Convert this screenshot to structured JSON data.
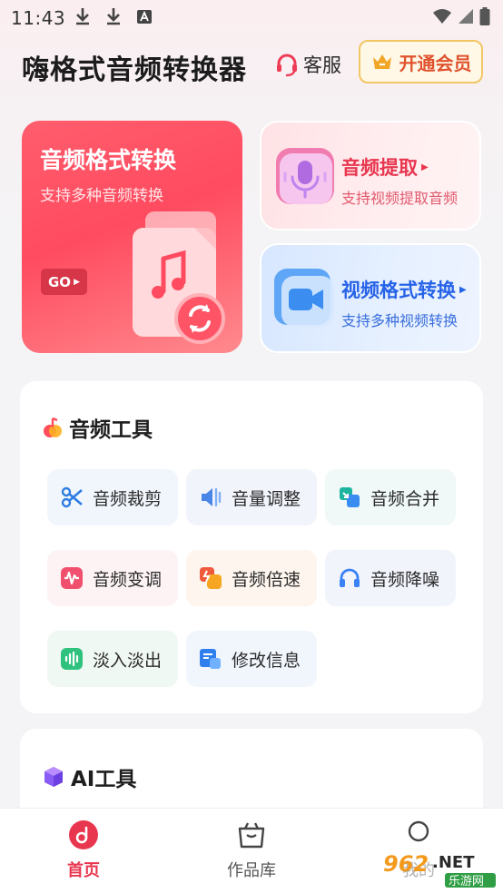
{
  "status_bar": {
    "time": "11:43",
    "icons": [
      "download-icon",
      "download-icon",
      "keyboard-a-icon",
      "wifi-icon",
      "signal-icon",
      "battery-icon"
    ]
  },
  "header": {
    "title": "嗨格式音频转换器",
    "service_label": "客服",
    "vip_label": "开通会员"
  },
  "features": {
    "main": {
      "title": "音频格式转换",
      "subtitle": "支持多种音频转换",
      "go_label": "GO"
    },
    "extract": {
      "title": "音频提取",
      "subtitle": "支持视频提取音频"
    },
    "video": {
      "title": "视频格式转换",
      "subtitle": "支持多种视频转换"
    }
  },
  "audio_tools": {
    "title": "音频工具",
    "items": [
      {
        "label": "音频裁剪",
        "icon": "scissors-icon",
        "color": "#2f7de1"
      },
      {
        "label": "音量调整",
        "icon": "volume-icon",
        "color": "#4a86e8"
      },
      {
        "label": "音频合并",
        "icon": "merge-icon",
        "color": "#1fb4a0"
      },
      {
        "label": "音频变调",
        "icon": "waveform-icon",
        "color": "#f0506e"
      },
      {
        "label": "音频倍速",
        "icon": "speed-icon",
        "color": "#f08a2c"
      },
      {
        "label": "音频降噪",
        "icon": "headphones-icon",
        "color": "#3b82f6"
      },
      {
        "label": "淡入淡出",
        "icon": "fade-icon",
        "color": "#2ec27e"
      },
      {
        "label": "修改信息",
        "icon": "info-edit-icon",
        "color": "#2f80ed"
      }
    ]
  },
  "ai_tools": {
    "title": "AI工具"
  },
  "bottom_nav": {
    "items": [
      {
        "label": "首页",
        "icon": "home-music-icon",
        "active": true
      },
      {
        "label": "作品库",
        "icon": "works-bag-icon",
        "active": false
      },
      {
        "label": "我的",
        "icon": "profile-icon",
        "active": false
      }
    ]
  },
  "watermark": "962.NET 乐游网",
  "colors": {
    "accent": "#e8364f",
    "vip_border": "#f2c665"
  }
}
